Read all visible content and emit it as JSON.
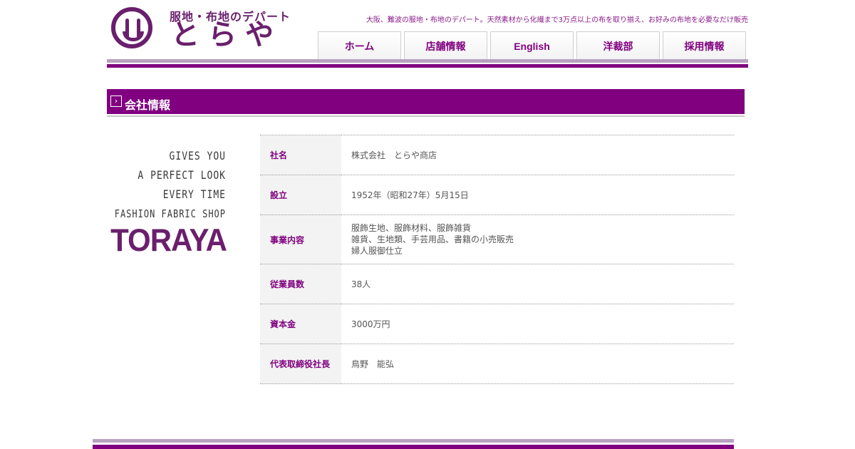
{
  "header": {
    "logo": {
      "subtitle": "服地・布地のデパート",
      "name": "とらや"
    },
    "tagline": "大阪、難波の服地・布地のデパート。天然素材から化繊まで3万点以上の布を取り揃え、お好みの布地を必要なだけ販売",
    "nav": [
      {
        "label": "ホーム"
      },
      {
        "label": "店舗情報"
      },
      {
        "label": "English"
      },
      {
        "label": "洋裁部"
      },
      {
        "label": "採用情報"
      }
    ]
  },
  "section": {
    "title": "会社情報"
  },
  "slogan": {
    "lines": [
      "GIVES YOU",
      "A PERFECT LOOK",
      "EVERY TIME",
      "FASHION FABRIC SHOP"
    ],
    "brand": "TORAYA"
  },
  "company_info": [
    {
      "label": "社名",
      "value": "株式会社　とらや商店"
    },
    {
      "label": "設立",
      "value": "1952年（昭和27年）5月15日"
    },
    {
      "label": "事業内容",
      "value": "服飾生地、服飾材料、服飾雑貨\n雑貨、生地類、手芸用品、書籍の小売販売\n婦人服御仕立"
    },
    {
      "label": "従業員数",
      "value": "38人"
    },
    {
      "label": "資本金",
      "value": "3000万円"
    },
    {
      "label": "代表取締役社長",
      "value": "鳥野　能弘"
    }
  ],
  "colors": {
    "accent": "#800080",
    "accent_light": "#b7a2c1",
    "row_header_bg": "#f3f3f3"
  }
}
